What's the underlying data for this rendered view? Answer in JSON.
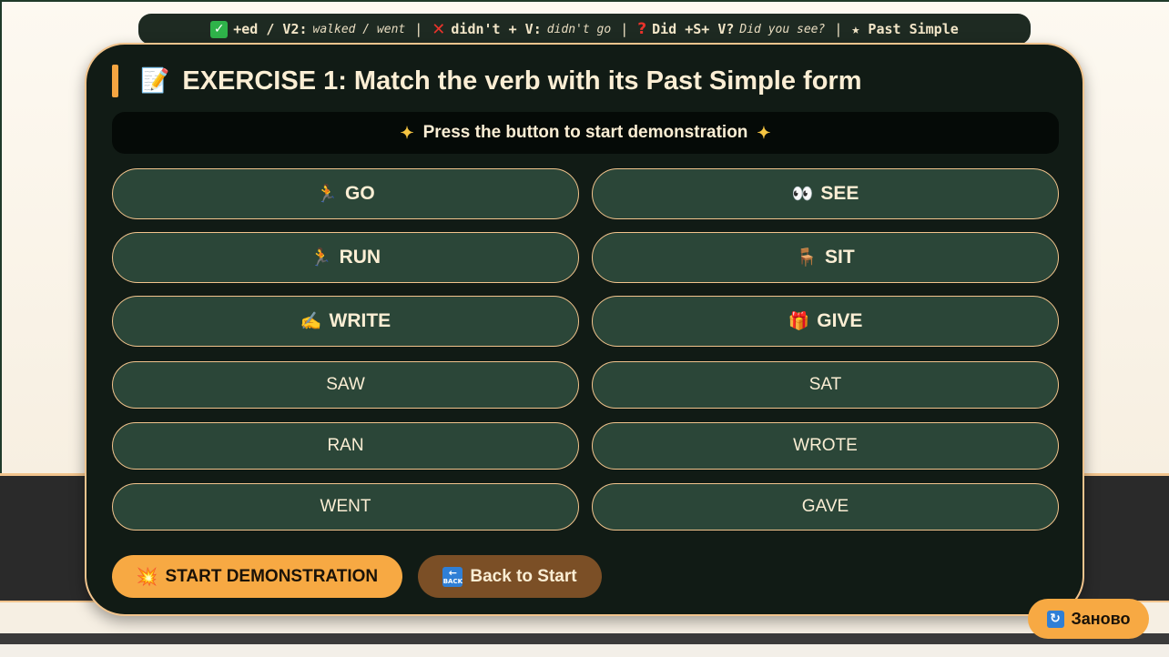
{
  "hint_bar": {
    "rule1_label": "+ed / V2:",
    "rule1_example": "walked / went",
    "rule2_label": "didn't + V:",
    "rule2_example": "didn't go",
    "rule3_label": "Did +S+ V?",
    "rule3_example": "Did you see?",
    "topic_label": "★ Past Simple"
  },
  "exercise": {
    "title_icon": "📝",
    "title": "EXERCISE 1: Match the verb with its Past Simple form",
    "status": "Press the button to start demonstration"
  },
  "verbs": [
    {
      "emoji": "🏃",
      "label": "GO"
    },
    {
      "emoji": "👀",
      "label": "SEE"
    },
    {
      "emoji": "🏃",
      "label": "RUN"
    },
    {
      "emoji": "🪑",
      "label": "SIT"
    },
    {
      "emoji": "✍",
      "label": "WRITE"
    },
    {
      "emoji": "🎁",
      "label": "GIVE"
    }
  ],
  "forms": [
    "SAW",
    "SAT",
    "RAN",
    "WROTE",
    "WENT",
    "GAVE"
  ],
  "buttons": {
    "start_icon": "💥",
    "start": "START DEMONSTRATION",
    "back_icon_text": "BACK",
    "back": "Back to Start",
    "restart": "Заново"
  },
  "colors": {
    "card_bg": "#111b15",
    "button_bg": "#2b4638",
    "accent": "#f7a943",
    "border": "#f2c48d",
    "back_button": "#7b4f26"
  }
}
